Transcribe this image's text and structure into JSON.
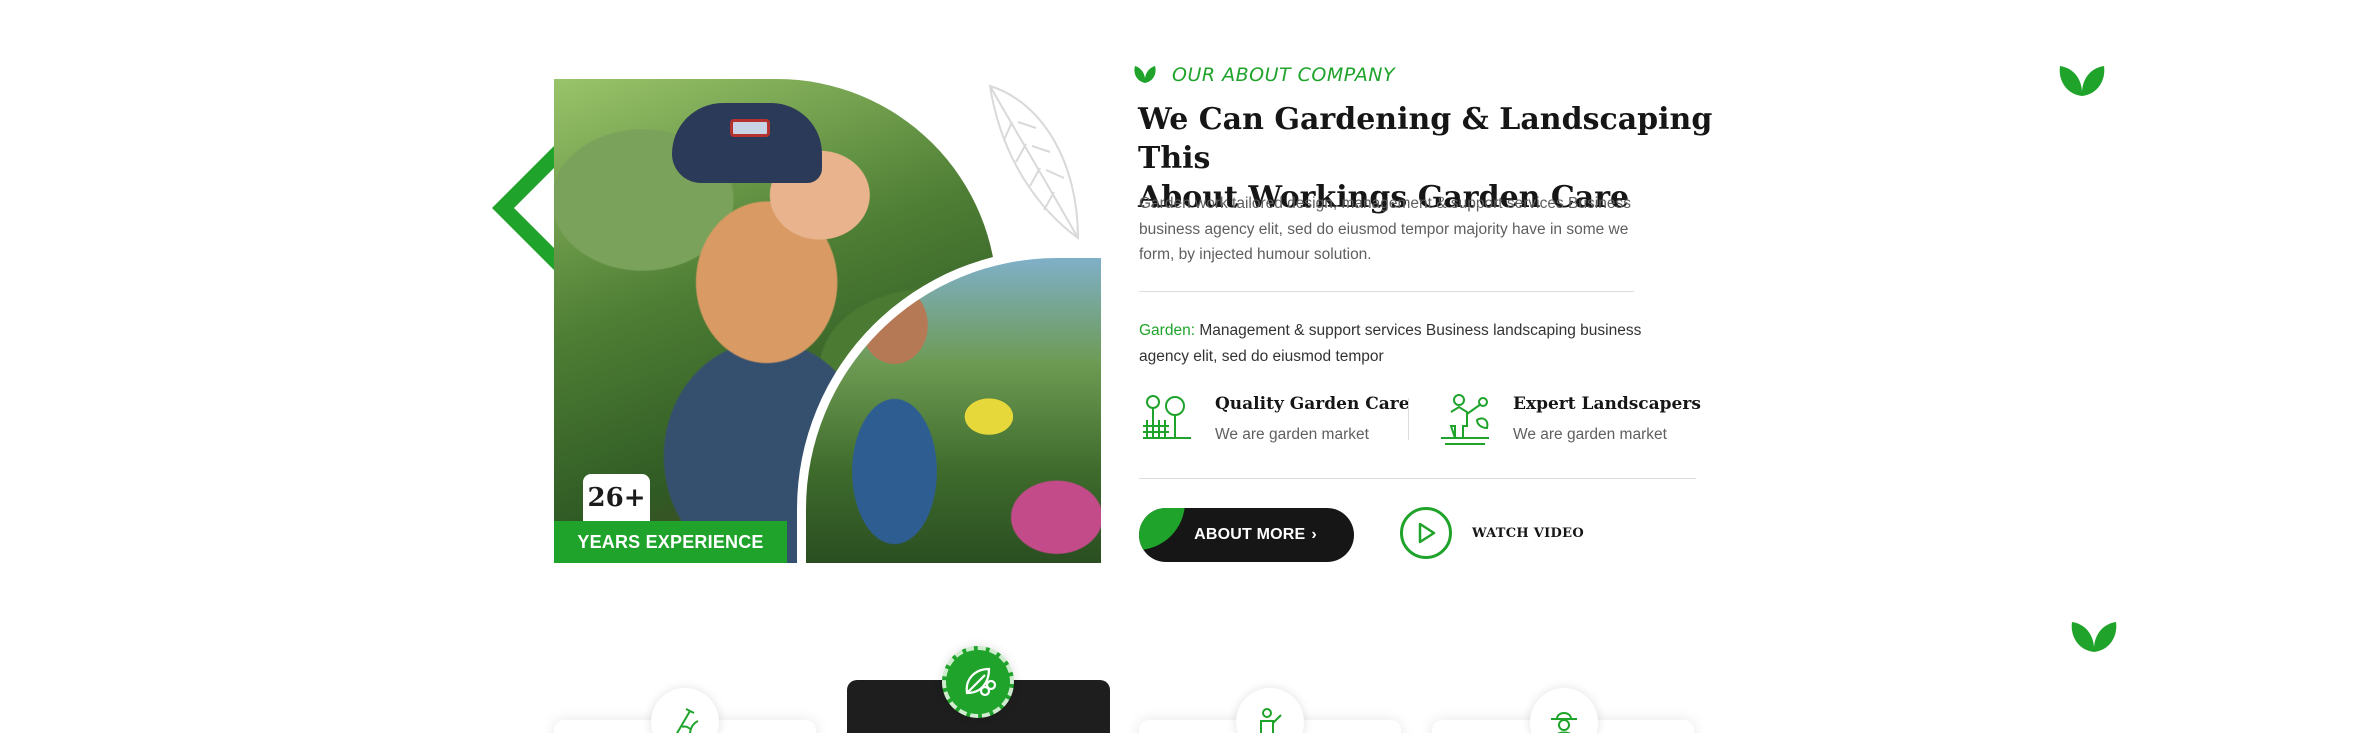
{
  "about": {
    "eyebrow": "OUR ABOUT COMPANY",
    "title_line1": "We Can Gardening & Landscaping This",
    "title_line2": "About Workings Garden Care",
    "description": "Garden work tailored design, management & support services Business business agency elit, sed do eiusmod tempor  majority have in some we form, by injected humour solution.",
    "garden_key": "Garden:",
    "garden_text": " Management & support services Business landscaping business agency elit, sed do eiusmod tempor",
    "features": [
      {
        "title": "Quality Garden Care",
        "subtitle": "We are garden market",
        "icon": "garden-trees-icon"
      },
      {
        "title": "Expert Landscapers",
        "subtitle": "We are garden market",
        "icon": "gardener-icon"
      }
    ],
    "cta_label": "ABOUT MORE",
    "watch_label": "WATCH VIDEO"
  },
  "experience": {
    "number": "26+",
    "label": "YEARS EXPERIENCE"
  },
  "service_icons": [
    "rake-plant-icon",
    "leaf-scissors-icon",
    "gardener-icon",
    "farmer-hat-icon"
  ],
  "colors": {
    "accent": "#1fa32b",
    "dark": "#161616",
    "text_muted": "#5f5f5f"
  }
}
